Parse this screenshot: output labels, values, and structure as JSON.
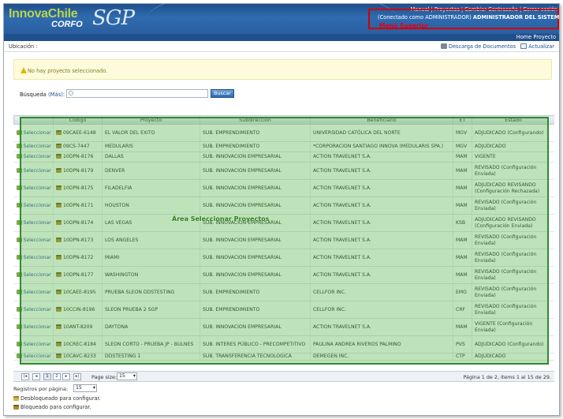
{
  "header": {
    "logo_main": "InnovaChile",
    "logo_sub": "CORFO",
    "logo_app": "SGP",
    "links": [
      "Manual",
      "Proyectos",
      "Cambiar Contraseña",
      "Cerrar sesión"
    ],
    "connected_prefix": "(Conectado como ADMINISTRADOR)",
    "connected_role": "ADMINISTRADOR DEL SISTEMA",
    "logout_note": "Menú Superior"
  },
  "homebar": {
    "link": "Home Proyecto"
  },
  "location": {
    "label": "Ubicación :",
    "download": "Descarga de Documentos",
    "refresh": "Actualizar"
  },
  "warning": {
    "text": "No hay proyecto seleccionado."
  },
  "search": {
    "label": "Búsqueda",
    "more": "(Más):",
    "placeholder": "",
    "button": "Buscar"
  },
  "grid": {
    "columns": [
      "",
      "Código",
      "Proyecto",
      "Subdirección",
      "Beneficiario",
      "ET",
      "Estado"
    ],
    "select_label": "Seleccionar",
    "rows": [
      {
        "codigo": "09CAEE-6148",
        "proyecto": "EL VALOR DEL EXITO",
        "sub": "SUB. EMPRENDIMIENTO",
        "benef": "UNIVERSIDAD CATÓLICA DEL NORTE",
        "et": "MGV",
        "estado": "ADJUDICADO (Configurando)"
      },
      {
        "codigo": "09CS-7447",
        "proyecto": "MEDULARIS",
        "sub": "SUB. EMPRENDIMIENTO",
        "benef": "*CORPORACION SANTIAGO INNOVA (MEDULARIS SPA.)",
        "et": "MGV",
        "estado": "ADJUDICADO"
      },
      {
        "codigo": "10DPN-8176",
        "proyecto": "DALLAS",
        "sub": "SUB. INNOVACION EMPRESARIAL",
        "benef": "ACTION TRAVELNET S.A.",
        "et": "MAM",
        "estado": "VIGENTE"
      },
      {
        "codigo": "10DPN-8179",
        "proyecto": "DENVER",
        "sub": "SUB. INNOVACION EMPRESARIAL",
        "benef": "ACTION TRAVELNET S.A.",
        "et": "MAM",
        "estado": "REVISADO (Configuración Enviada)"
      },
      {
        "codigo": "10DPN-8175",
        "proyecto": "FILADELFIA",
        "sub": "SUB. INNOVACION EMPRESARIAL",
        "benef": "ACTION TRAVELNET S.A.",
        "et": "MAM",
        "estado": "ADJUDICADO REVISANDO (Configuración Rechazada)"
      },
      {
        "codigo": "10DPN-8171",
        "proyecto": "HOUSTON",
        "sub": "SUB. INNOVACION EMPRESARIAL",
        "benef": "ACTION TRAVELNET S.A.",
        "et": "MAM",
        "estado": "REVISADO (Configuración Enviada)"
      },
      {
        "codigo": "10DPN-8174",
        "proyecto": "LAS VEGAS",
        "sub": "SUB. INNOVACION EMPRESARIAL",
        "benef": "ACTION TRAVELNET S.A.",
        "et": "KSB",
        "estado": "ADJUDICADO REVISANDO (Configuración Enviada)"
      },
      {
        "codigo": "10DPN-8173",
        "proyecto": "LOS ANGELES",
        "sub": "SUB. INNOVACION EMPRESARIAL",
        "benef": "ACTION TRAVELNET S.A.",
        "et": "MAM",
        "estado": "REVISADO (Configuración Enviada)"
      },
      {
        "codigo": "10DPN-8172",
        "proyecto": "MIAMI",
        "sub": "SUB. INNOVACION EMPRESARIAL",
        "benef": "ACTION TRAVELNET S.A.",
        "et": "MAM",
        "estado": "REVISADO (Configuración Enviada)"
      },
      {
        "codigo": "10DPN-8177",
        "proyecto": "WASHINGTON",
        "sub": "SUB. INNOVACION EMPRESARIAL",
        "benef": "ACTION TRAVELNET S.A.",
        "et": "MAM",
        "estado": "REVISADO (Configuración Enviada)"
      },
      {
        "codigo": "10CAEE-8195",
        "proyecto": "PRUEBA SLEON DDSTESTING",
        "sub": "SUB. EMPRENDIMIENTO",
        "benef": "CELLFOR INC.",
        "et": "EMG",
        "estado": "REVISADO (Configuración Enviada)"
      },
      {
        "codigo": "10CCIN-8196",
        "proyecto": "SLEON PRUEBA 2 SGP",
        "sub": "SUB. EMPRENDIMIENTO",
        "benef": "CELLFOR INC.",
        "et": "CRF",
        "estado": "REVISADO (Configuración Enviada)"
      },
      {
        "codigo": "10ANT-8209",
        "proyecto": "DAYTONA",
        "sub": "SUB. INNOVACION EMPRESARIAL",
        "benef": "ACTION TRAVELNET S.A.",
        "et": "MAM",
        "estado": "VIGENTE (Configuración Enviada)"
      },
      {
        "codigo": "10CREC-8184",
        "proyecto": "SLEON CORTO - PRUEBA JP - BULNES",
        "sub": "SUB. INTERES PÚBLICO - PRECOMPETITIVO",
        "benef": "PAULINA ANDREA RIVEROS PALMINO",
        "et": "PVS",
        "estado": "ADJUDICADO (Configurando)"
      },
      {
        "codigo": "10CAVC-8233",
        "proyecto": "DDSTESTING 1",
        "sub": "SUB. TRANSFERENCIA TECNOLOGICA",
        "benef": "DEMEGEN INC.",
        "et": "CTP",
        "estado": "ADJUDICADO"
      }
    ]
  },
  "overlay": {
    "label": "Área Seleccionar Proyectos"
  },
  "pager": {
    "pages": [
      "1",
      "2"
    ],
    "page_size_label": "Page size:",
    "page_size_value": "15",
    "info": "Página 1 de 2, items 1 al 15 de 29."
  },
  "footer": {
    "regpp_label": "Registros por página:",
    "regpp_value": "15",
    "legend_unlocked": "Desbloqueado para configurar.",
    "legend_locked": "Bloqueado para configurar."
  }
}
